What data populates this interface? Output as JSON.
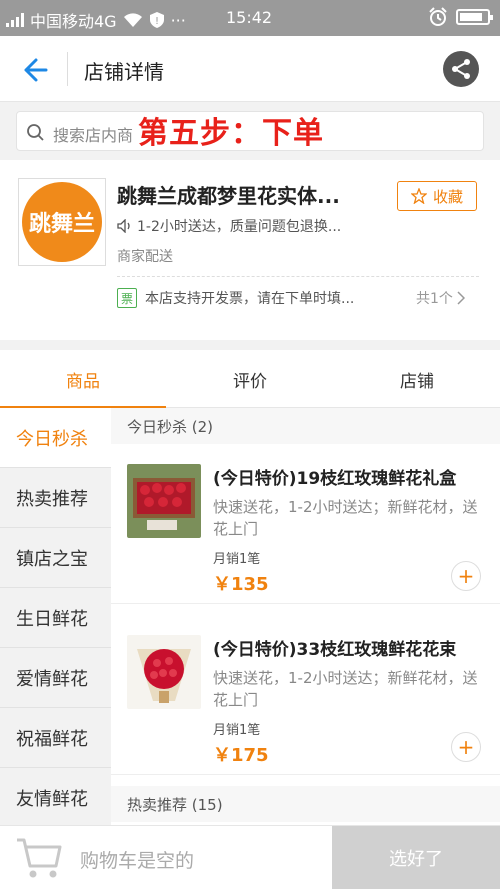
{
  "status_bar": {
    "carrier": "中国移动4G",
    "time": "15:42",
    "dots": "···"
  },
  "header": {
    "title": "店铺详情"
  },
  "search": {
    "placeholder": "搜索店内商",
    "step_overlay": "第五步：下单"
  },
  "store": {
    "logo_text": "跳舞兰",
    "name": "跳舞兰成都梦里花实体...",
    "fav_label": "收藏",
    "notice": "1-2小时送达，质量问题包退换...",
    "delivery": "商家配送",
    "invoice_badge": "票",
    "invoice": "本店支持开发票，请在下单时填...",
    "coupon_count": "共1个"
  },
  "tabs": [
    "商品",
    "评价",
    "店铺"
  ],
  "categories": [
    "今日秒杀",
    "热卖推荐",
    "镇店之宝",
    "生日鲜花",
    "爱情鲜花",
    "祝福鲜花",
    "友情鲜花"
  ],
  "sections": [
    {
      "title": "今日秒杀 (2)"
    },
    {
      "title": "热卖推荐 (15)"
    }
  ],
  "products": [
    {
      "name": "(今日特价)19枝红玫瑰鲜花礼盒",
      "desc": "快速送花，1-2小时送达；新鲜花材，送花上门",
      "sales": "月销1笔",
      "price": "￥135"
    },
    {
      "name": "(今日特价)33枝红玫瑰鲜花花束",
      "desc": "快速送花，1-2小时送达；新鲜花材，送花上门",
      "sales": "月销1笔",
      "price": "￥175"
    }
  ],
  "cart": {
    "empty_text": "购物车是空的",
    "settle_label": "选好了"
  },
  "colors": {
    "accent": "#f0820f",
    "overlay_red": "#e8211a",
    "status_bar": "#9a9a9a"
  }
}
